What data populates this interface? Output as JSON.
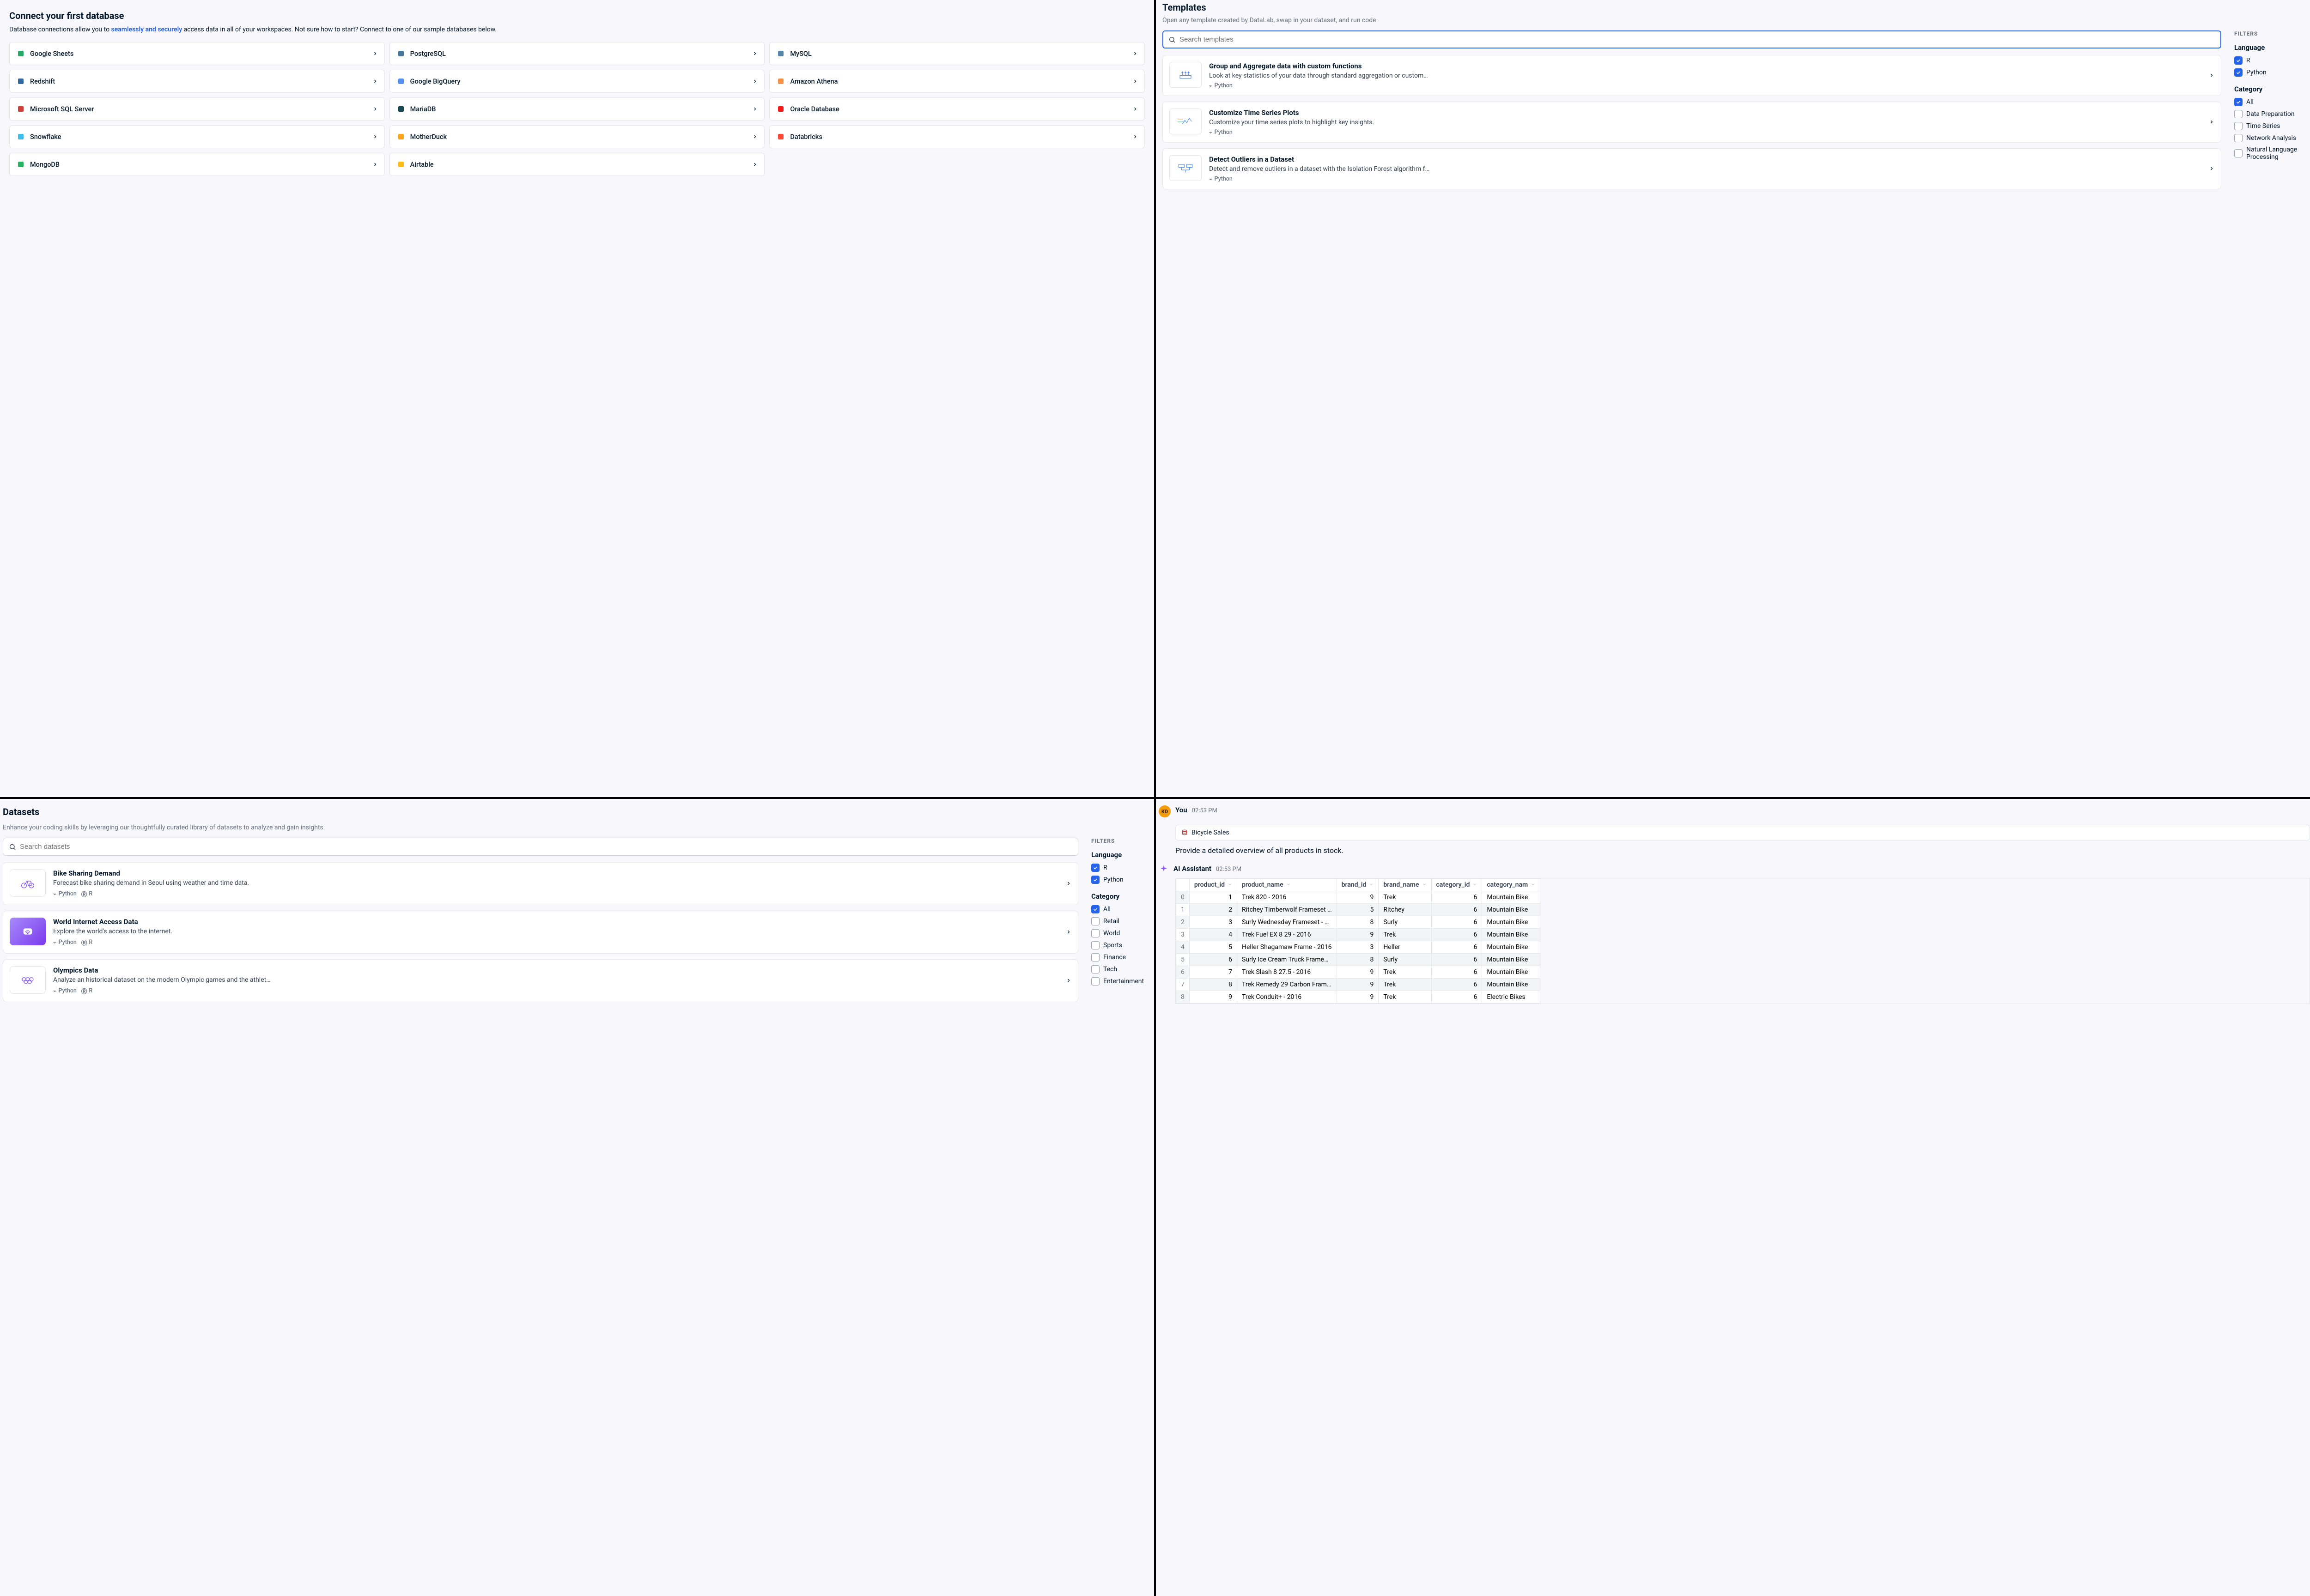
{
  "p1": {
    "title": "Connect your first database",
    "subtitle_a": "Database connections allow you to ",
    "subtitle_link": "seamlessly and securely",
    "subtitle_b": " access data in all of your workspaces. Not sure how to start? Connect to one of our sample databases below.",
    "databases": [
      {
        "name": "Google Sheets",
        "color": "#0f9d58"
      },
      {
        "name": "PostgreSQL",
        "color": "#336791"
      },
      {
        "name": "MySQL",
        "color": "#4479a1"
      },
      {
        "name": "Redshift",
        "color": "#205b97"
      },
      {
        "name": "Google BigQuery",
        "color": "#4285f4"
      },
      {
        "name": "Amazon Athena",
        "color": "#f58536"
      },
      {
        "name": "Microsoft SQL Server",
        "color": "#cc2927"
      },
      {
        "name": "MariaDB",
        "color": "#003545"
      },
      {
        "name": "Oracle Database",
        "color": "#f80000"
      },
      {
        "name": "Snowflake",
        "color": "#29b5e8"
      },
      {
        "name": "MotherDuck",
        "color": "#ff9900"
      },
      {
        "name": "Databricks",
        "color": "#ff3621"
      },
      {
        "name": "MongoDB",
        "color": "#13aa52"
      },
      {
        "name": "Airtable",
        "color": "#fcb400"
      }
    ]
  },
  "p2": {
    "title": "Templates",
    "subtitle": "Open any template created by DataLab, swap in your dataset, and run code.",
    "search_placeholder": "Search templates",
    "filters_label": "FILTERS",
    "lang_title": "Language",
    "cat_title": "Category",
    "langs": [
      {
        "label": "R",
        "checked": true
      },
      {
        "label": "Python",
        "checked": true
      }
    ],
    "cats": [
      {
        "label": "All",
        "checked": true
      },
      {
        "label": "Data Preparation",
        "checked": false
      },
      {
        "label": "Time Series",
        "checked": false
      },
      {
        "label": "Network Analysis",
        "checked": false
      },
      {
        "label": "Natural Language Processing",
        "checked": false
      }
    ],
    "templates": [
      {
        "title": "Group and Aggregate data with custom functions",
        "desc": "Look at key statistics of your data through standard aggregation or custom…",
        "lang": "Python"
      },
      {
        "title": "Customize Time Series Plots",
        "desc": "Customize your time series plots to highlight key insights.",
        "lang": "Python"
      },
      {
        "title": "Detect Outliers in a Dataset",
        "desc": "Detect and remove outliers in a dataset with the Isolation Forest algorithm f…",
        "lang": "Python"
      }
    ]
  },
  "p3": {
    "title": "Datasets",
    "subtitle": "Enhance your coding skills by leveraging our thoughtfully curated library of datasets to analyze and gain insights.",
    "search_placeholder": "Search datasets",
    "filters_label": "FILTERS",
    "lang_title": "Language",
    "cat_title": "Category",
    "langs": [
      {
        "label": "R",
        "checked": true
      },
      {
        "label": "Python",
        "checked": true
      }
    ],
    "cats": [
      {
        "label": "All",
        "checked": true
      },
      {
        "label": "Retail",
        "checked": false
      },
      {
        "label": "World",
        "checked": false
      },
      {
        "label": "Sports",
        "checked": false
      },
      {
        "label": "Finance",
        "checked": false
      },
      {
        "label": "Tech",
        "checked": false
      },
      {
        "label": "Entertainment",
        "checked": false
      }
    ],
    "datasets": [
      {
        "title": "Bike Sharing Demand",
        "desc": "Forecast bike sharing demand in Seoul using weather and time data.",
        "langs": [
          "Python",
          "R"
        ],
        "thumb": "bike"
      },
      {
        "title": "World Internet Access Data",
        "desc": "Explore the world's access to the internet.",
        "langs": [
          "Python",
          "R"
        ],
        "thumb": "wifi"
      },
      {
        "title": "Olympics Data",
        "desc": "Analyze an historical dataset on the modern Olympic games and the athlet…",
        "langs": [
          "Python",
          "R"
        ],
        "thumb": "rings"
      }
    ]
  },
  "p4": {
    "you_label": "You",
    "you_time": "02:53 PM",
    "avatar_initials": "KD",
    "chip_label": "Bicycle Sales",
    "prompt": "Provide a detailed overview of all products in stock.",
    "ai_label": "AI Assistant",
    "ai_time": "02:53 PM",
    "columns": [
      "product_id",
      "product_name",
      "brand_id",
      "brand_name",
      "category_id",
      "category_nam"
    ],
    "rows": [
      {
        "idx": 0,
        "product_id": 1,
        "product_name": "Trek 820 - 2016",
        "brand_id": 9,
        "brand_name": "Trek",
        "category_id": 6,
        "category_name": "Mountain Bike"
      },
      {
        "idx": 1,
        "product_id": 2,
        "product_name": "Ritchey Timberwolf Frameset …",
        "brand_id": 5,
        "brand_name": "Ritchey",
        "category_id": 6,
        "category_name": "Mountain Bike"
      },
      {
        "idx": 2,
        "product_id": 3,
        "product_name": "Surly Wednesday Frameset - …",
        "brand_id": 8,
        "brand_name": "Surly",
        "category_id": 6,
        "category_name": "Mountain Bike"
      },
      {
        "idx": 3,
        "product_id": 4,
        "product_name": "Trek Fuel EX 8 29 - 2016",
        "brand_id": 9,
        "brand_name": "Trek",
        "category_id": 6,
        "category_name": "Mountain Bike"
      },
      {
        "idx": 4,
        "product_id": 5,
        "product_name": "Heller Shagamaw Frame - 2016",
        "brand_id": 3,
        "brand_name": "Heller",
        "category_id": 6,
        "category_name": "Mountain Bike"
      },
      {
        "idx": 5,
        "product_id": 6,
        "product_name": "Surly Ice Cream Truck Frame…",
        "brand_id": 8,
        "brand_name": "Surly",
        "category_id": 6,
        "category_name": "Mountain Bike"
      },
      {
        "idx": 6,
        "product_id": 7,
        "product_name": "Trek Slash 8 27.5 - 2016",
        "brand_id": 9,
        "brand_name": "Trek",
        "category_id": 6,
        "category_name": "Mountain Bike"
      },
      {
        "idx": 7,
        "product_id": 8,
        "product_name": "Trek Remedy 29 Carbon Fram…",
        "brand_id": 9,
        "brand_name": "Trek",
        "category_id": 6,
        "category_name": "Mountain Bike"
      },
      {
        "idx": 8,
        "product_id": 9,
        "product_name": "Trek Conduit+ - 2016",
        "brand_id": 9,
        "brand_name": "Trek",
        "category_id": 6,
        "category_name": "Electric Bikes"
      }
    ]
  }
}
